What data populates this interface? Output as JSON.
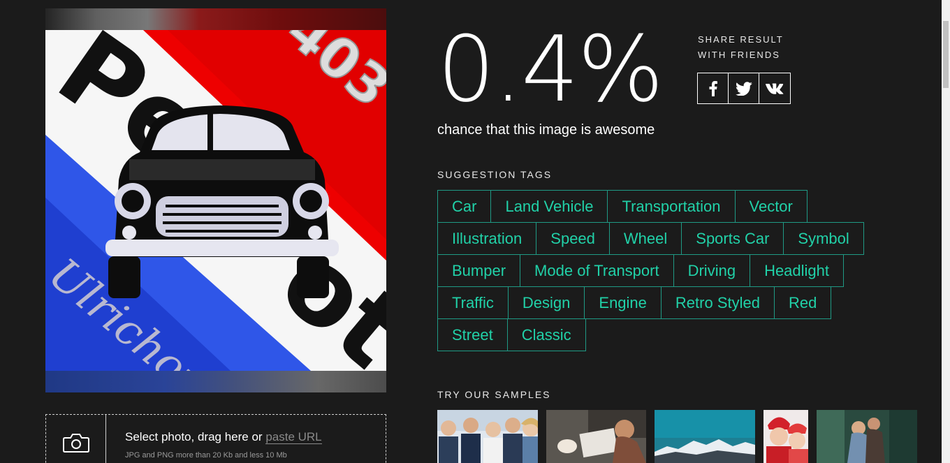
{
  "result": {
    "percent": "0.4%",
    "chance_text": "chance that this image is awesome"
  },
  "share": {
    "label_line1": "SHARE RESULT",
    "label_line2": "WITH FRIENDS",
    "buttons": [
      {
        "icon": "facebook-icon",
        "glyph": "f"
      },
      {
        "icon": "twitter-icon",
        "glyph": "t"
      },
      {
        "icon": "vk-icon",
        "glyph": "vk"
      }
    ]
  },
  "suggestion_heading": "SUGGESTION TAGS",
  "tags": [
    [
      "Car",
      "Land Vehicle",
      "Transportation",
      "Vector"
    ],
    [
      "Illustration",
      "Speed",
      "Wheel",
      "Sports Car",
      "Symbol"
    ],
    [
      "Bumper",
      "Mode of Transport",
      "Driving",
      "Headlight"
    ],
    [
      "Traffic",
      "Design",
      "Engine",
      "Retro Styled",
      "Red"
    ],
    [
      "Street",
      "Classic"
    ]
  ],
  "samples_heading": "TRY OUR SAMPLES",
  "upload": {
    "main_text": "Select photo, drag here or",
    "paste_url": "paste URL",
    "hint": "JPG and PNG more than 20 Kb and less 10 Mb"
  },
  "poster": {
    "model_number": "403",
    "brand_text": "Peugeot",
    "signature": "Ulrichou"
  },
  "colors": {
    "background": "#1b1b1b",
    "accent": "#21d1a8",
    "tag_border": "#1f9a85"
  }
}
